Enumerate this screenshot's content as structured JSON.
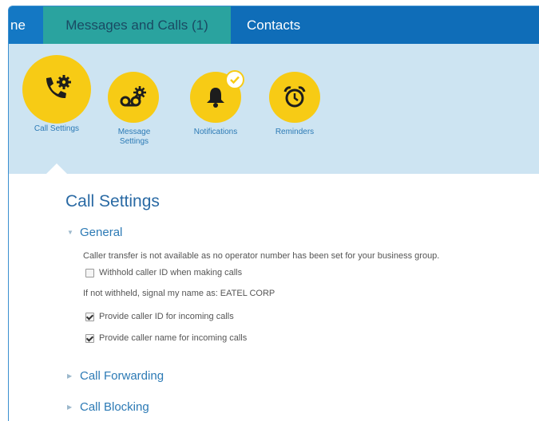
{
  "topnav": {
    "home_partial": "ne",
    "messages_tab": "Messages and Calls (1)",
    "contacts_tab": "Contacts"
  },
  "subnav": {
    "items": [
      {
        "label": "Call Settings"
      },
      {
        "label_line1": "Message",
        "label_line2": "Settings"
      },
      {
        "label": "Notifications"
      },
      {
        "label": "Reminders"
      }
    ]
  },
  "main": {
    "title": "Call Settings",
    "general": {
      "heading": "General",
      "info": "Caller transfer is not available as no operator number has been set for your business group.",
      "withhold_label": "Withhold caller ID when making calls",
      "withhold_checked": false,
      "signal_label": "If not withheld, signal my name as: EATEL CORP",
      "provide_id_label": "Provide caller ID for incoming calls",
      "provide_id_checked": true,
      "provide_name_label": "Provide caller name for incoming calls",
      "provide_name_checked": true
    },
    "call_forwarding": "Call Forwarding",
    "call_blocking": "Call Blocking"
  },
  "colors": {
    "nav_blue": "#0f6db8",
    "active_tab": "#2aa39f",
    "subnav_bg": "#cde4f2",
    "icon_yellow": "#f7cb15",
    "heading_blue": "#2a6aa4"
  }
}
